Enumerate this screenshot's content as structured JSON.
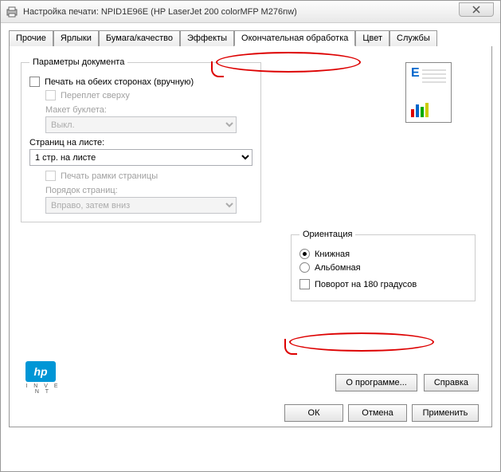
{
  "window": {
    "title": "Настройка печати: NPID1E96E (HP LaserJet 200 colorMFP M276nw)"
  },
  "tabs": [
    "Прочие",
    "Ярлыки",
    "Бумага/качество",
    "Эффекты",
    "Окончательная обработка",
    "Цвет",
    "Службы"
  ],
  "active_tab": "Окончательная обработка",
  "docparams": {
    "legend": "Параметры документа",
    "print_both_sides": "Печать на обеих сторонах (вручную)",
    "flip_top": "Переплет сверху",
    "booklet_layout": "Макет буклета:",
    "booklet_value": "Выкл.",
    "pages_per_sheet": "Страниц на листе:",
    "pages_value": "1 стр. на листе",
    "print_borders": "Печать рамки страницы",
    "page_order": "Порядок страниц:",
    "order_value": "Вправо, затем вниз"
  },
  "orientation": {
    "legend": "Ориентация",
    "portrait": "Книжная",
    "landscape": "Альбомная",
    "rotate180": "Поворот на 180 градусов"
  },
  "buttons": {
    "about": "О программе...",
    "help": "Справка",
    "ok": "ОК",
    "cancel": "Отмена",
    "apply": "Применить"
  },
  "hp_sub": "I N V E N T"
}
